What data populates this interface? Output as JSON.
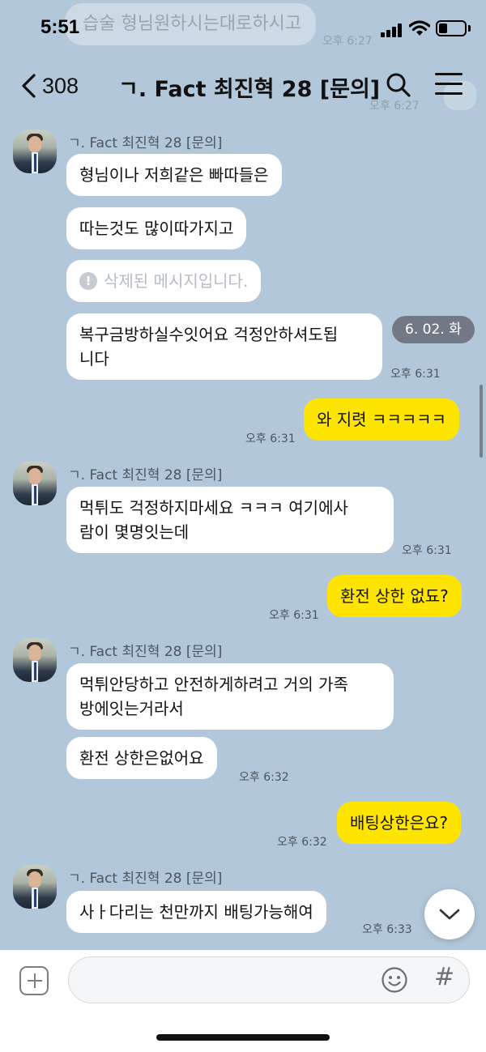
{
  "status_bar": {
    "time": "5:51"
  },
  "background_ghost": {
    "text": "습술 형님원하시는대로하시고",
    "time1": "오후 6:27",
    "time2": "오후 6:27"
  },
  "header": {
    "back_count": "308",
    "title": "ㄱ. Fact 최진혁 28 [문의]"
  },
  "colors": {
    "chat_background": "#b2c7d9",
    "my_bubble": "#fee500",
    "their_bubble": "#ffffff",
    "date_pill": "#717a84"
  },
  "messages": {
    "group1": {
      "sender": "ㄱ. Fact 최진혁 28 [문의]",
      "m1": "형님이나 저희같은 빠따들은",
      "m2": "따는것도 많이따가지고",
      "m3_deleted": "삭제된 메시지입니다.",
      "m4": "복구금방하실수잇어요 걱정안하셔도됩\n니다",
      "time": "오후 6:31"
    },
    "date_pill": "6. 02. 화",
    "me1": {
      "text": "와 지렷 ㅋㅋㅋㅋㅋ",
      "time": "오후 6:31"
    },
    "group2": {
      "sender": "ㄱ. Fact 최진혁 28 [문의]",
      "m1": "먹튀도 걱정하지마세요 ㅋㅋㅋ 여기에사\n람이 몇명잇는데",
      "time": "오후 6:31"
    },
    "me2": {
      "text": "환전 상한 없됴?",
      "time": "오후 6:31"
    },
    "group3": {
      "sender": "ㄱ. Fact 최진혁 28 [문의]",
      "m1": "먹튀안당하고 안전하게하려고 거의 가족\n방에잇는거라서",
      "m2": "환전 상한은없어요",
      "time": "오후 6:32"
    },
    "me3": {
      "text": "배팅상한은요?",
      "time": "오후 6:32"
    },
    "group4": {
      "sender": "ㄱ. Fact 최진혁 28 [문의]",
      "m1": "사ㅏ다리는 천만까지 배팅가능해여",
      "time": "오후 6:33"
    }
  },
  "input": {
    "placeholder": "",
    "value": ""
  },
  "icons": {
    "back": "chevron-left-icon",
    "search": "search-icon",
    "menu": "hamburger-menu-icon",
    "add": "plus-square-icon",
    "emoji": "smiley-icon",
    "hash": "hash-icon",
    "scroll_down": "chevron-down-icon"
  }
}
